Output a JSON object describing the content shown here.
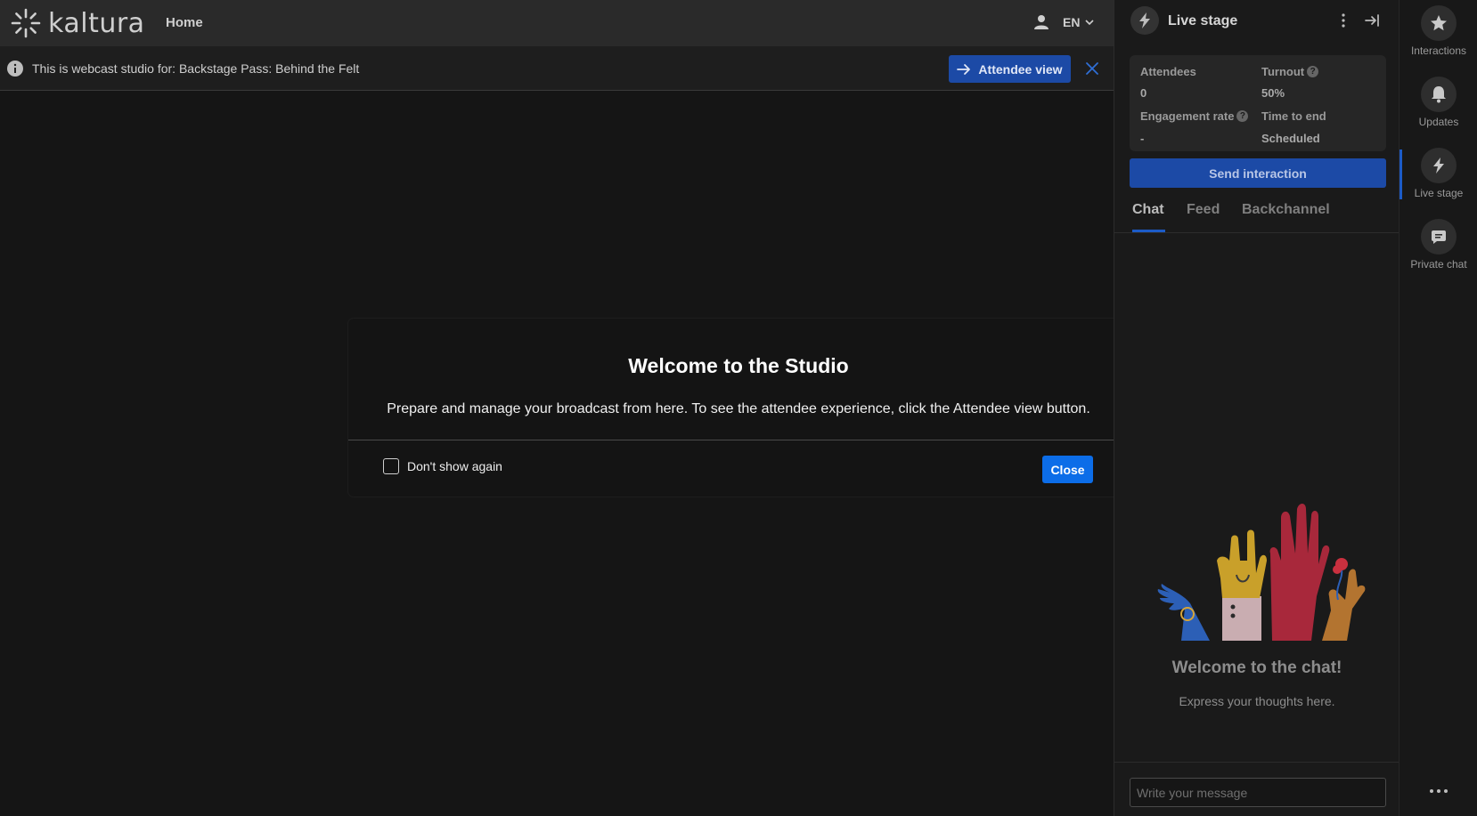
{
  "topbar": {
    "brand": "kaltura",
    "nav_home": "Home",
    "lang": "EN"
  },
  "infobar": {
    "text": "This is webcast studio for: Backstage Pass: Behind the Felt",
    "attendee_view_label": "Attendee view"
  },
  "modal": {
    "title": "Welcome to the Studio",
    "body": "Prepare and manage your broadcast from here. To see the attendee experience, click the Attendee view button.",
    "dont_show_label": "Don't show again",
    "close_label": "Close"
  },
  "panel": {
    "title": "Live stage",
    "stats": {
      "attendees_label": "Attendees",
      "attendees_value": "0",
      "turnout_label": "Turnout",
      "turnout_value": "50%",
      "engagement_label": "Engagement rate",
      "engagement_value": "-",
      "time_label": "Time to end",
      "time_value": "Scheduled"
    },
    "send_interaction_label": "Send interaction",
    "tabs": [
      {
        "label": "Chat",
        "active": true
      },
      {
        "label": "Feed",
        "active": false
      },
      {
        "label": "Backchannel",
        "active": false
      }
    ],
    "chat_welcome": "Welcome to the chat!",
    "chat_sub": "Express your thoughts here.",
    "chat_placeholder": "Write your message"
  },
  "rail": {
    "items": [
      {
        "label": "Interactions",
        "icon": "star-icon"
      },
      {
        "label": "Updates",
        "icon": "bell-icon"
      },
      {
        "label": "Live stage",
        "icon": "bolt-icon",
        "active": true
      },
      {
        "label": "Private chat",
        "icon": "chat-bubble-icon"
      }
    ]
  },
  "colors": {
    "accent": "#1c4aa6",
    "primary_button": "#0c6de8",
    "background": "#151515"
  }
}
